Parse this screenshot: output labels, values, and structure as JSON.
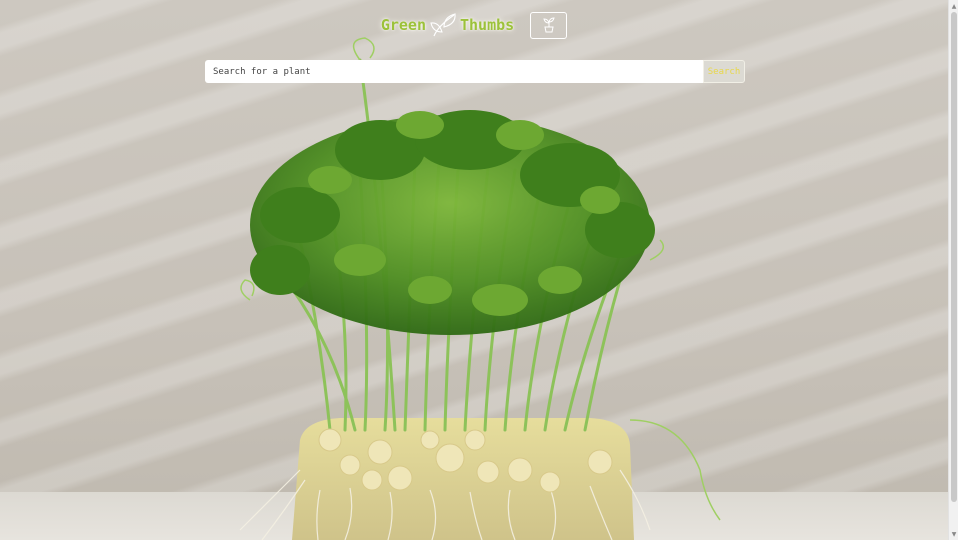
{
  "header": {
    "logo_left": "Green",
    "logo_right": "Thumbs",
    "logo_icon": "leaf-icon",
    "plant_button_icon": "potted-plant-icon"
  },
  "search": {
    "placeholder": "Search for a plant",
    "value": "",
    "button_label": "Search"
  },
  "hero": {
    "image": "pea-shoots-microgreens"
  },
  "colors": {
    "brand_green": "#9cc23a",
    "search_button_text": "#e8d84a"
  }
}
